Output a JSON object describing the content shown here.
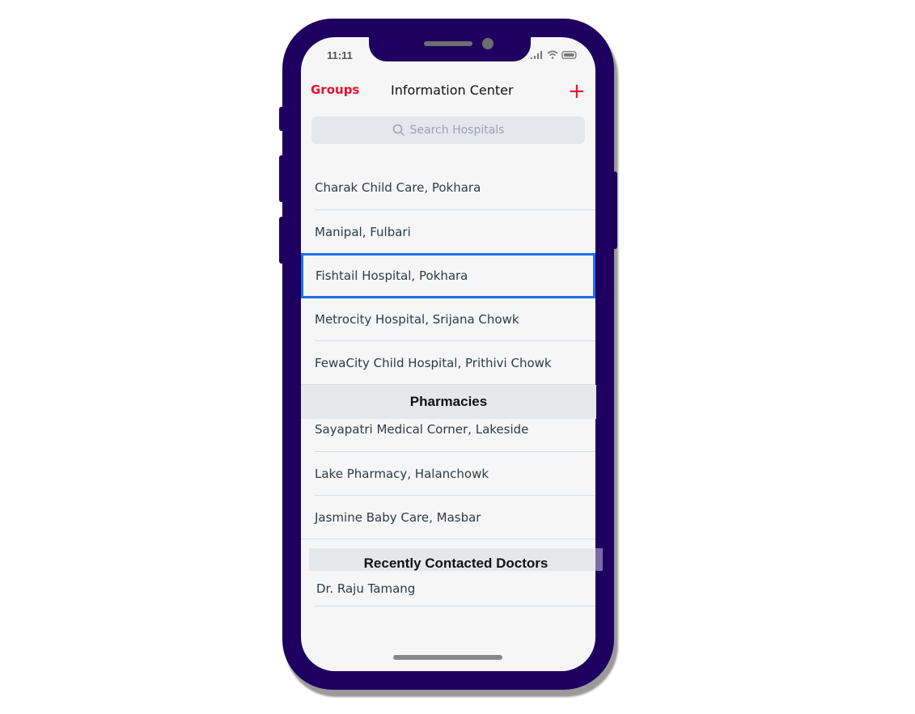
{
  "status_bar": {
    "time": "11:11",
    "icons": [
      "signal-icon",
      "wifi-icon",
      "battery-icon"
    ]
  },
  "nav_bar": {
    "left_button": "Groups",
    "title": "Information Center",
    "right_button": "+",
    "accent_color": "#e8102e"
  },
  "search": {
    "placeholder": "Search Hospitals",
    "icon": "search-icon"
  },
  "hospitals": [
    {
      "name": "Charak Child Care, Pokhara"
    },
    {
      "name": "Manipal, Fulbari"
    },
    {
      "name": "Fishtail Hospital, Pokhara",
      "selected": true
    },
    {
      "name": "Metrocity Hospital, Srijana Chowk"
    },
    {
      "name": "FewaCity Child Hospital, Prithivi Chowk"
    }
  ],
  "pharmacies": {
    "header": "Pharmacies",
    "items": [
      {
        "name": "Sayapatri Medical Corner, Lakeside"
      },
      {
        "name": "Lake Pharmacy, Halanchowk"
      },
      {
        "name": "Jasmine Baby Care, Masbar"
      }
    ]
  },
  "doctors": {
    "header": "Recently Contacted Doctors",
    "items": [
      {
        "name": "Dr. Raju Tamang"
      }
    ]
  },
  "colors": {
    "phone_frame": "#1e0060",
    "selection": "#1f6ff0"
  }
}
